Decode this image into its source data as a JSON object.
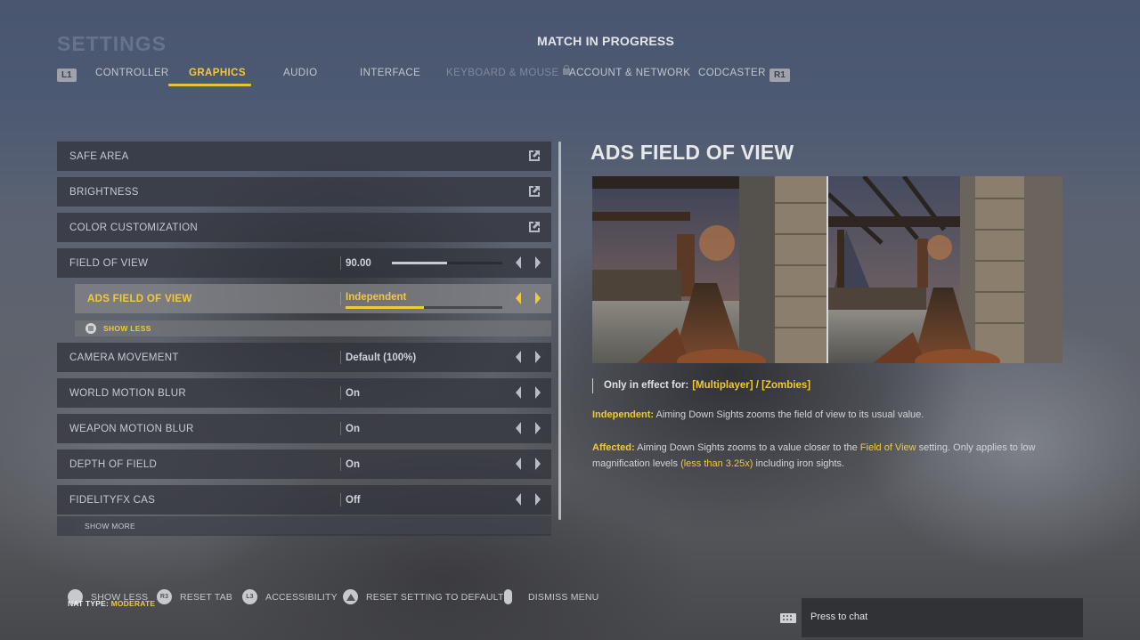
{
  "header": {
    "title": "SETTINGS",
    "match_status": "MATCH IN PROGRESS",
    "left_bumper": "L1",
    "right_bumper": "R1"
  },
  "tabs": [
    {
      "label": "CONTROLLER",
      "state": "normal"
    },
    {
      "label": "GRAPHICS",
      "state": "active"
    },
    {
      "label": "AUDIO",
      "state": "normal"
    },
    {
      "label": "INTERFACE",
      "state": "normal"
    },
    {
      "label": "KEYBOARD & MOUSE",
      "state": "disabled",
      "locked": true
    },
    {
      "label": "ACCOUNT & NETWORK",
      "state": "normal"
    },
    {
      "label": "CODCASTER",
      "state": "normal"
    }
  ],
  "settings": {
    "safe_area": {
      "label": "SAFE AREA",
      "icon": "external-link-icon"
    },
    "brightness": {
      "label": "BRIGHTNESS",
      "icon": "external-link-icon"
    },
    "color_customization": {
      "label": "COLOR CUSTOMIZATION",
      "icon": "external-link-icon"
    },
    "field_of_view": {
      "label": "FIELD OF VIEW",
      "value": "90.00",
      "slider_fraction": 0.5
    },
    "ads_field_of_view": {
      "label": "ADS FIELD OF VIEW",
      "value": "Independent",
      "option_fraction": 0.5,
      "selected": true
    },
    "show_less": {
      "label": "SHOW LESS"
    },
    "camera_movement": {
      "label": "CAMERA MOVEMENT",
      "value": "Default (100%)"
    },
    "world_motion_blur": {
      "label": "WORLD MOTION BLUR",
      "value": "On"
    },
    "weapon_motion_blur": {
      "label": "WEAPON MOTION BLUR",
      "value": "On"
    },
    "depth_of_field": {
      "label": "DEPTH OF FIELD",
      "value": "On"
    },
    "fidelityfx_cas": {
      "label": "FIDELITYFX CAS",
      "value": "Off"
    },
    "show_more": {
      "label": "SHOW MORE"
    }
  },
  "detail": {
    "title": "ADS FIELD OF VIEW",
    "effect_prefix": "Only in effect for:",
    "effect_modes": "[Multiplayer] / [Zombies]",
    "independent_key": "Independent:",
    "independent_text": " Aiming Down Sights zooms the field of view to its usual value.",
    "affected_key": "Affected:",
    "affected_text_1": " Aiming Down Sights zooms to a value closer to the ",
    "affected_hl_1": "Field of View",
    "affected_text_2": " setting. Only applies to low magnification levels ",
    "affected_hl_2": "(less than 3.25x)",
    "affected_text_3": " including iron sights."
  },
  "footer": {
    "show_less": "SHOW LESS",
    "reset_tab": "RESET TAB",
    "reset_tab_btn": "R3",
    "accessibility": "ACCESSIBILITY",
    "accessibility_btn": "L3",
    "reset_default": "RESET SETTING TO DEFAULT",
    "dismiss": "DISMISS MENU",
    "nat_label": "NAT TYPE:",
    "nat_value": "MODERATE"
  },
  "chat": {
    "placeholder": "Press to chat"
  },
  "colors": {
    "accent": "#f2c93b",
    "row_bg": "#30323a",
    "selected_row_bg": "#87878a"
  }
}
